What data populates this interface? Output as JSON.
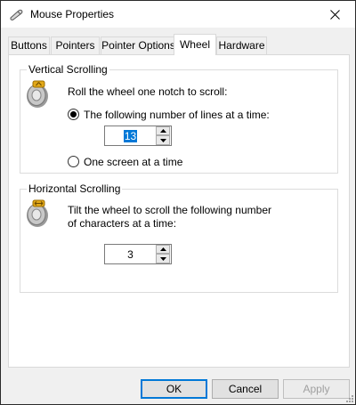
{
  "window": {
    "title": "Mouse Properties",
    "icon": "mouse-icon"
  },
  "tabs": [
    {
      "label": "Buttons"
    },
    {
      "label": "Pointers"
    },
    {
      "label": "Pointer Options"
    },
    {
      "label": "Wheel",
      "active": true
    },
    {
      "label": "Hardware"
    }
  ],
  "vertical": {
    "group_label": "Vertical Scrolling",
    "description": "Roll the wheel one notch to scroll:",
    "option_lines": "The following number of lines at a time:",
    "lines_value": "13",
    "option_screen": "One screen at a time",
    "selected": "lines"
  },
  "horizontal": {
    "group_label": "Horizontal Scrolling",
    "description_line1": "Tilt the wheel to scroll the following number",
    "description_line2": "of characters at a time:",
    "chars_value": "3"
  },
  "footer": {
    "ok_label": "OK",
    "cancel_label": "Cancel",
    "apply_label": "Apply"
  },
  "colors": {
    "accent": "#0078d7",
    "window_bg": "#f0f0f0",
    "panel_bg": "#ffffff"
  }
}
